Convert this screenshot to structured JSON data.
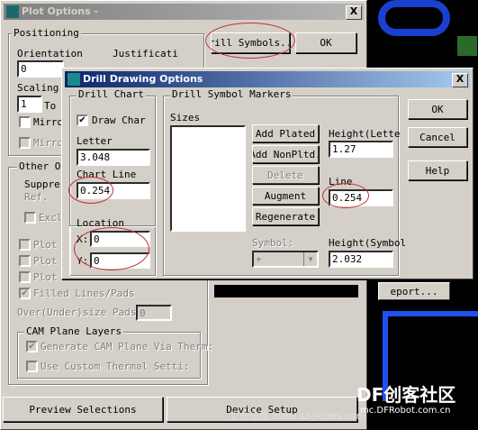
{
  "plot_options": {
    "title": "Plot Options -",
    "close_glyph": "X",
    "positioning_label": "Positioning",
    "orientation_label": "Orientation",
    "orientation_value": "0",
    "justification_label": "Justificati",
    "scaling_label": "Scaling:",
    "scaling_value": "1",
    "scaling_to_label": "To",
    "mirror_label_1": "Mirro",
    "mirror_label_2": "Mirro",
    "drill_symbols_button": "rill Symbols..",
    "ok_button": "OK",
    "other_options_label": "Other Op",
    "suppress_label": "Suppres",
    "ref_label": "Ref.",
    "exclude_label": "Excl",
    "plot_labels": [
      "Plot",
      "Plot",
      "Plot"
    ],
    "filled_lines_label": "Filled Lines/Pads",
    "over_under_label": "Over(Under)size Pads",
    "over_under_value": "0",
    "cam_plane_label": "CAM Plane Layers",
    "generate_cam_label": "Generate CAM Plane Via Therm:",
    "custom_thermal_label": "Use Custom Thermal Setti:",
    "report_button": "eport...",
    "preview_button": "Preview Selections",
    "device_setup_button": "Device Setup"
  },
  "drill_dialog": {
    "title": "Drill Drawing Options",
    "close_glyph": "X",
    "drill_chart_label": "Drill Chart",
    "draw_chart_label": "Draw Char",
    "draw_chart_checked": "✔",
    "letter_label": "Letter",
    "letter_value": "3.048",
    "chart_line_label": "Chart Line",
    "chart_line_value": "0.254",
    "location_label": "Location",
    "x_label": "X:",
    "x_value": "0",
    "y_label": "Y:",
    "y_value": "0",
    "markers_label": "Drill Symbol Markers",
    "sizes_label": "Sizes",
    "add_plated_button": "Add Plated",
    "add_nonplated_button": "Add NonPltd.",
    "delete_button": "Delete",
    "augment_button": "Augment",
    "regenerate_button": "Regenerate",
    "height_letter_label": "Height(Lette",
    "height_letter_value": "1.27",
    "line_label": "Line",
    "line_value": "0.254",
    "symbol_label": "Symbol:",
    "symbol_value": "+",
    "height_symbol_label": "Height(Symbol",
    "height_symbol_value": "2.032",
    "ok_button": "OK",
    "cancel_button": "Cancel",
    "help_button": "Help"
  },
  "watermark": {
    "logo_text": "DF创客社区",
    "url_text": "mc.DFRobot.com.cn",
    "bottom_text": "立创论坛 www.sz-jlcbbs.com"
  },
  "colors": {
    "face": "#d4d0c8",
    "active_title": "#0a246a",
    "annotation": "#c0303a",
    "background": "#0a1a3a"
  }
}
